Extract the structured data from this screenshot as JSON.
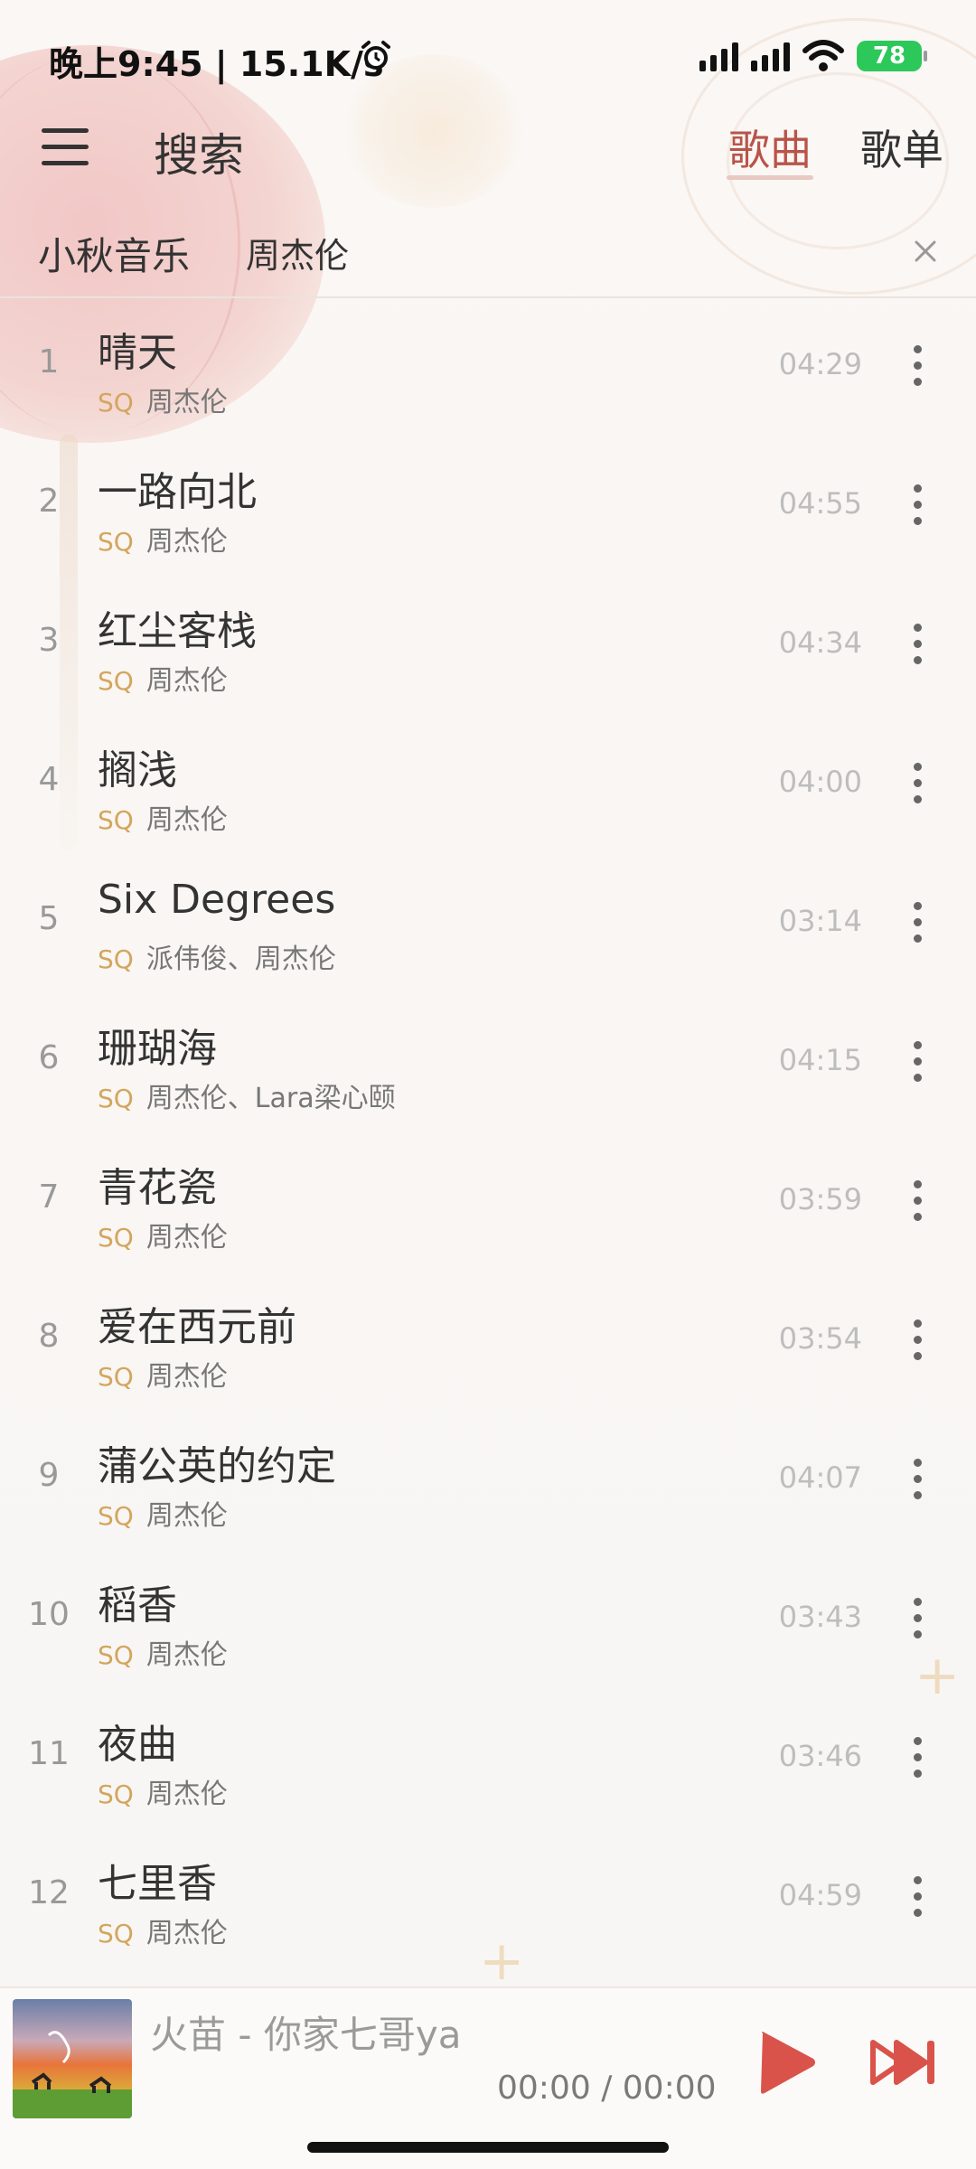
{
  "status_bar": {
    "time": "晚上9:45 | 15.1K/s",
    "battery": "78"
  },
  "header": {
    "title": "搜索",
    "tabs": [
      {
        "label": "歌曲",
        "active": true
      },
      {
        "label": "歌单",
        "active": false
      }
    ]
  },
  "search": {
    "source": "小秋音乐",
    "query": "周杰伦"
  },
  "sq_label": "SQ",
  "songs": [
    {
      "index": "1",
      "title": "晴天",
      "artist": "周杰伦",
      "duration": "04:29"
    },
    {
      "index": "2",
      "title": "一路向北",
      "artist": "周杰伦",
      "duration": "04:55"
    },
    {
      "index": "3",
      "title": "红尘客栈",
      "artist": "周杰伦",
      "duration": "04:34"
    },
    {
      "index": "4",
      "title": "搁浅",
      "artist": "周杰伦",
      "duration": "04:00"
    },
    {
      "index": "5",
      "title": "Six Degrees",
      "artist": "派伟俊、周杰伦",
      "duration": "03:14"
    },
    {
      "index": "6",
      "title": "珊瑚海",
      "artist": "周杰伦、Lara梁心颐",
      "duration": "04:15"
    },
    {
      "index": "7",
      "title": "青花瓷",
      "artist": "周杰伦",
      "duration": "03:59"
    },
    {
      "index": "8",
      "title": "爱在西元前",
      "artist": "周杰伦",
      "duration": "03:54"
    },
    {
      "index": "9",
      "title": "蒲公英的约定",
      "artist": "周杰伦",
      "duration": "04:07"
    },
    {
      "index": "10",
      "title": "稻香",
      "artist": "周杰伦",
      "duration": "03:43"
    },
    {
      "index": "11",
      "title": "夜曲",
      "artist": "周杰伦",
      "duration": "03:46"
    },
    {
      "index": "12",
      "title": "七里香",
      "artist": "周杰伦",
      "duration": "04:59"
    }
  ],
  "player": {
    "now_playing": "火苗 - 你家七哥ya",
    "time": "00:00 / 00:00"
  },
  "colors": {
    "accent": "#b8544a",
    "sq": "#d3a65e",
    "play": "#d9534a",
    "battery": "#2dc85a"
  },
  "icons": {
    "menu": "hamburger-icon",
    "clear": "close-icon",
    "more": "more-vertical-icon",
    "play": "play-icon",
    "next": "skip-next-icon"
  }
}
